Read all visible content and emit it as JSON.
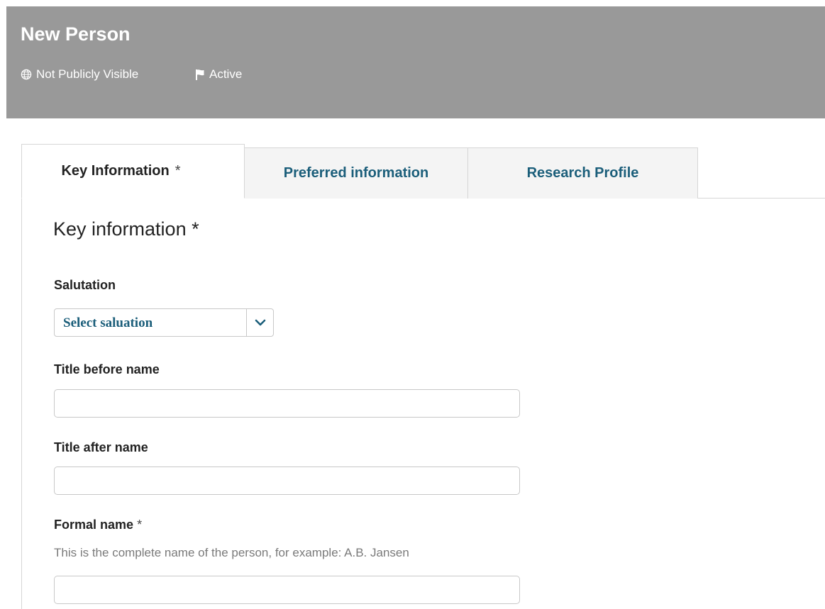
{
  "header": {
    "title": "New Person",
    "visibility": "Not Publicly Visible",
    "status": "Active",
    "background_color": "#999999",
    "visibility_icon": "globe-icon",
    "status_icon": "flag-icon"
  },
  "tabs": [
    {
      "label": "Key Information",
      "required_marker": "*",
      "active": true
    },
    {
      "label": "Preferred information",
      "active": false
    },
    {
      "label": "Research Profile",
      "active": false
    }
  ],
  "section": {
    "title": "Key information *"
  },
  "fields": {
    "salutation": {
      "label": "Salutation",
      "selected": "Select saluation",
      "icon": "chevron-down-icon"
    },
    "title_before": {
      "label": "Title before name",
      "value": ""
    },
    "title_after": {
      "label": "Title after name",
      "value": ""
    },
    "formal_name": {
      "label": "Formal name",
      "required_marker": "*",
      "help": "This is the complete name of the person, for example: A.B. Jansen",
      "value": ""
    }
  },
  "colors": {
    "accent": "#1b5e7a",
    "border": "#d6d6d6",
    "help_text": "#7a7a7a"
  }
}
